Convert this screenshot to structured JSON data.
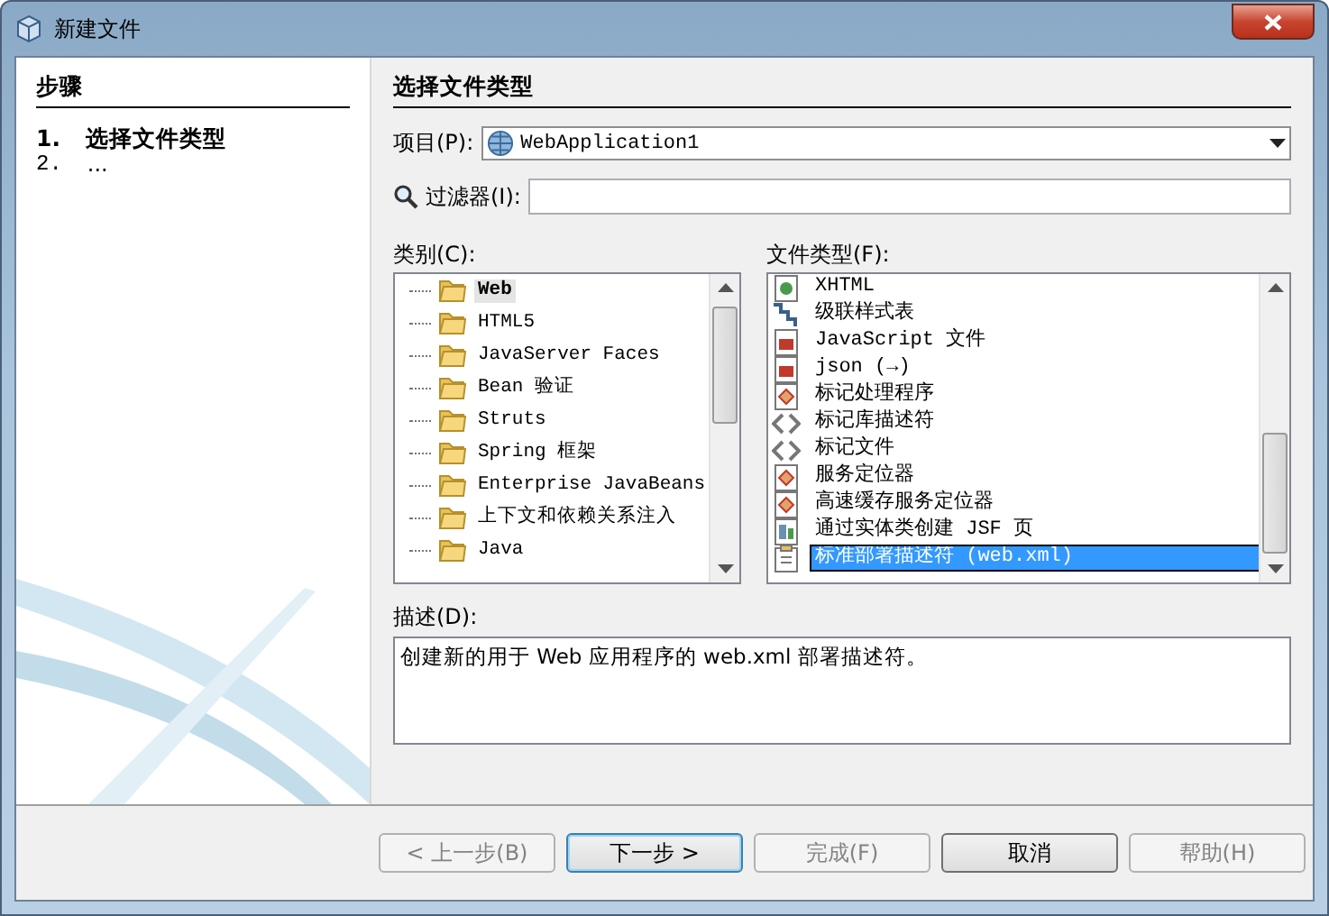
{
  "window": {
    "title": "新建文件"
  },
  "steps": {
    "heading": "步骤",
    "items": [
      {
        "number": "1.",
        "label": "选择文件类型",
        "selected": true
      },
      {
        "number": "2.",
        "label": "...",
        "selected": false
      }
    ]
  },
  "panel": {
    "heading": "选择文件类型"
  },
  "project": {
    "label": "项目(P):",
    "value": "WebApplication1"
  },
  "filter": {
    "label": "过滤器(I):"
  },
  "categories": {
    "label": "类别(C):",
    "items": [
      {
        "label": "Web",
        "selected": true
      },
      {
        "label": "HTML5",
        "selected": false
      },
      {
        "label": "JavaServer Faces",
        "selected": false
      },
      {
        "label": "Bean 验证",
        "selected": false
      },
      {
        "label": "Struts",
        "selected": false
      },
      {
        "label": "Spring 框架",
        "selected": false
      },
      {
        "label": "Enterprise JavaBeans",
        "selected": false
      },
      {
        "label": "上下文和依赖关系注入",
        "selected": false
      },
      {
        "label": "Java",
        "selected": false
      }
    ]
  },
  "file_types": {
    "label": "文件类型(F):",
    "items": [
      {
        "label": "XHTML",
        "kind": "page",
        "selected": false
      },
      {
        "label": "级联样式表",
        "kind": "stylesheet",
        "selected": false
      },
      {
        "label": "JavaScript 文件",
        "kind": "script",
        "selected": false
      },
      {
        "label": "json (→)",
        "kind": "script",
        "selected": false
      },
      {
        "label": "标记处理程序",
        "kind": "class",
        "selected": false
      },
      {
        "label": "标记库描述符",
        "kind": "tags",
        "selected": false
      },
      {
        "label": "标记文件",
        "kind": "tags",
        "selected": false
      },
      {
        "label": "服务定位器",
        "kind": "class",
        "selected": false
      },
      {
        "label": "高速缓存服务定位器",
        "kind": "class",
        "selected": false
      },
      {
        "label": "通过实体类创建 JSF 页",
        "kind": "entity",
        "selected": false
      },
      {
        "label": "标准部署描述符 (web.xml)",
        "kind": "descriptor",
        "selected": true
      }
    ]
  },
  "description": {
    "label": "描述(D):",
    "text": "创建新的用于 Web 应用程序的 web.xml 部署描述符。"
  },
  "buttons": [
    {
      "label": "< 上一步(B)",
      "disabled": true,
      "default": false
    },
    {
      "label": "下一步 >",
      "disabled": false,
      "default": true
    },
    {
      "label": "完成(F)",
      "disabled": true,
      "default": false
    },
    {
      "label": "取消",
      "disabled": false,
      "default": false
    },
    {
      "label": "帮助(H)",
      "disabled": true,
      "default": false
    }
  ]
}
